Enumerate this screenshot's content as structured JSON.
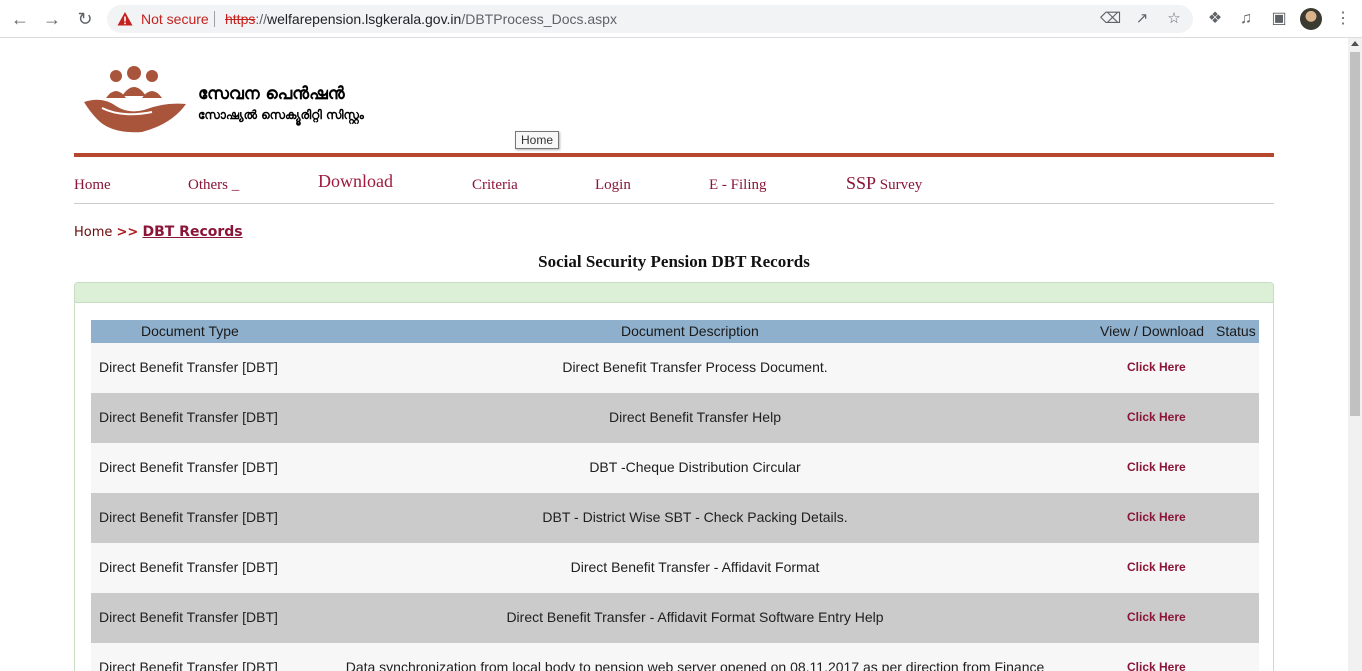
{
  "browser": {
    "security_label": "Not secure",
    "url_scheme": "https",
    "url_host": "welfarepension.lsgkerala.gov.in",
    "url_path": "/DBTProcess_Docs.aspx"
  },
  "header": {
    "brand_line1": "സേവന പെൻഷൻ",
    "brand_line2": "സോഷ്യൽ സെക്യൂരിറ്റി സിസ്റ്റം",
    "tooltip": "Home",
    "accent_color": "#b5472d"
  },
  "menu": {
    "home": "Home",
    "others": "Others _",
    "download": "Download",
    "criteria": "Criteria",
    "login": "Login",
    "efiling": "E - Filing",
    "ssp": "SSP",
    "survey": "Survey"
  },
  "breadcrumb": {
    "home": "Home",
    "separator": ">>",
    "current": "DBT Records"
  },
  "page_title": "Social Security Pension DBT Records",
  "table": {
    "headers": {
      "type": "Document Type",
      "description": "Document Description",
      "action": "View / Download",
      "status": "Status"
    },
    "rows": [
      {
        "type": "Direct Benefit Transfer [DBT]",
        "description": "Direct Benefit Transfer Process Document.",
        "link": "Click Here"
      },
      {
        "type": "Direct Benefit Transfer [DBT]",
        "description": "Direct Benefit Transfer Help",
        "link": "Click Here"
      },
      {
        "type": "Direct Benefit Transfer [DBT]",
        "description": "DBT -Cheque Distribution Circular",
        "link": "Click Here"
      },
      {
        "type": "Direct Benefit Transfer [DBT]",
        "description": "DBT - District Wise SBT - Check Packing Details.",
        "link": "Click Here"
      },
      {
        "type": "Direct Benefit Transfer [DBT]",
        "description": "Direct Benefit Transfer - Affidavit Format",
        "link": "Click Here"
      },
      {
        "type": "Direct Benefit Transfer [DBT]",
        "description": "Direct Benefit Transfer - Affidavit Format Software Entry Help",
        "link": "Click Here"
      },
      {
        "type": "Direct Benefit Transfer [DBT]",
        "description": "Data synchronization from local body to pension web server opened on 08.11.2017 as per direction from Finance",
        "link": "Click Here"
      }
    ]
  }
}
